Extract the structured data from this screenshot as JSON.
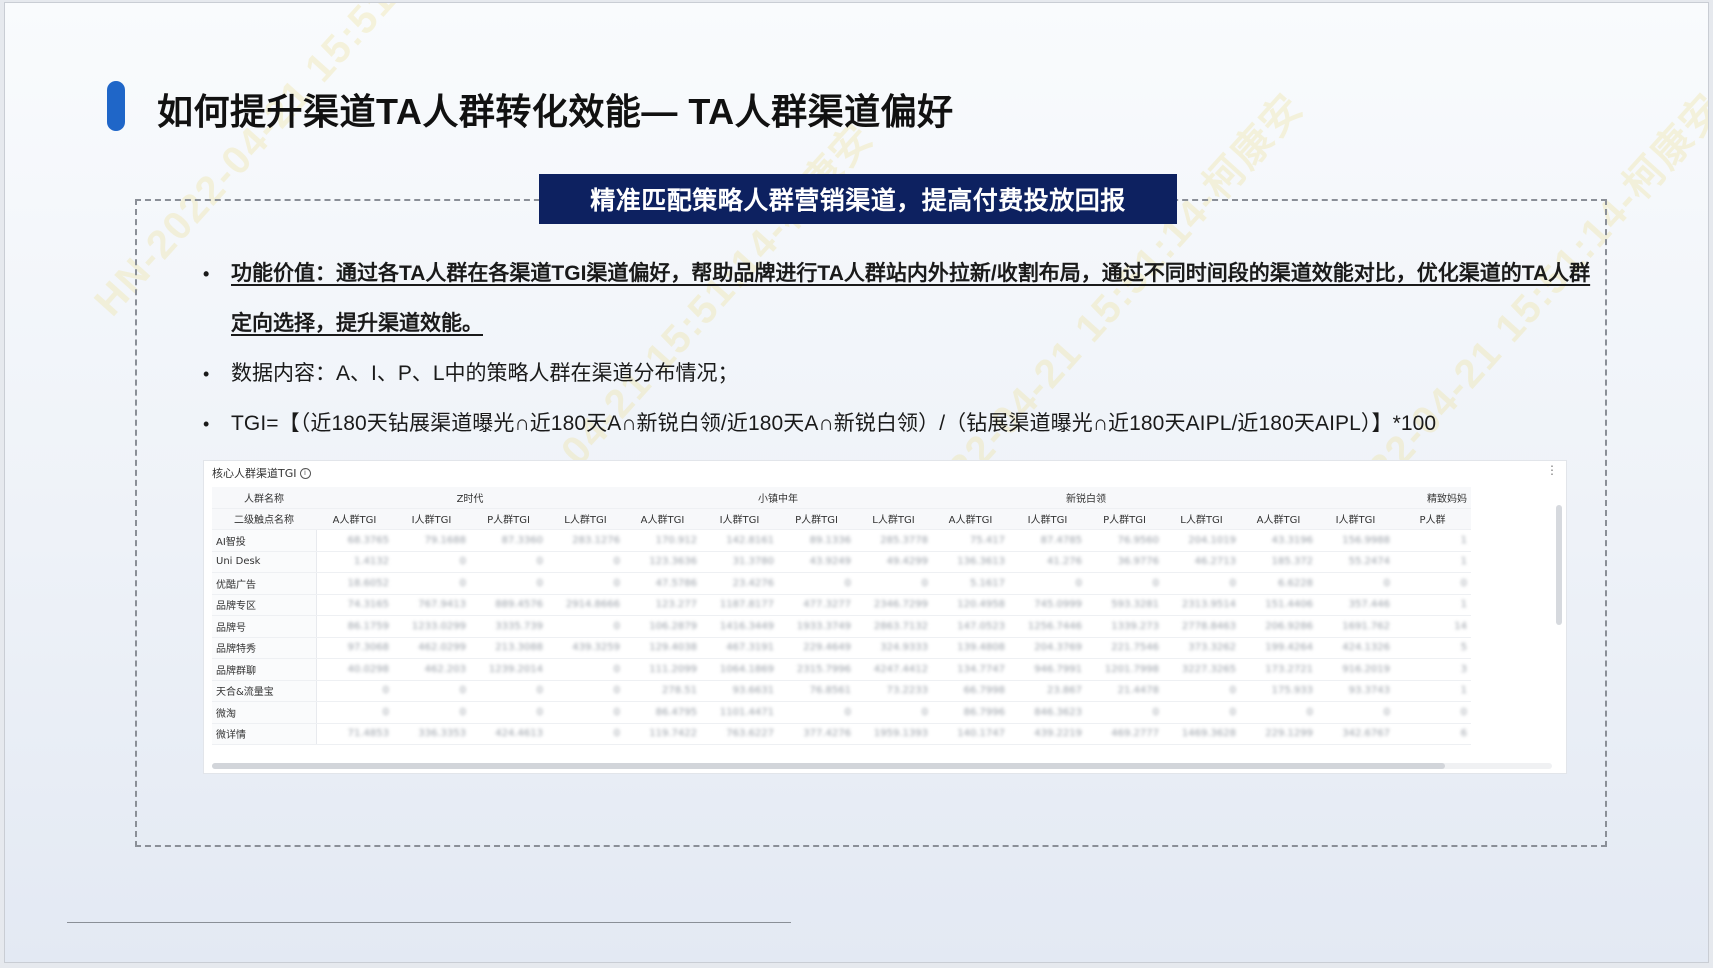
{
  "slide": {
    "title": "如何提升渠道TA人群转化效能— TA人群渠道偏好",
    "banner": "精准匹配策略人群营销渠道，提高付费投放回报",
    "bullets": [
      {
        "text": "功能价值：通过各TA人群在各渠道TGI渠道偏好，帮助品牌进行TA人群站内外拉新/收割布局，通过不同时间段的渠道效能对比，优化渠道的TA人群定向选择，提升渠道效能。",
        "style": "strong"
      },
      {
        "text": "数据内容：A、I、P、L中的策略人群在渠道分布情况；",
        "style": "normal"
      },
      {
        "text": "TGI=【（近180天钻展渠道曝光∩近180天A∩新锐白领/近180天A∩新锐白领）/（钻展渠道曝光∩近180天AIPL/近180天AIPL）】*100",
        "style": "tgi"
      }
    ],
    "bullet_symbol": "•"
  },
  "table": {
    "title": "核心人群渠道TGI",
    "info_icon": "info-icon",
    "more_icon": "more-icon",
    "corner_top": "人群名称",
    "corner_bottom": "二级触点名称",
    "groups": [
      {
        "name": "Z时代",
        "span": 4
      },
      {
        "name": "小镇中年",
        "span": 4
      },
      {
        "name": "新锐白领",
        "span": 4
      },
      {
        "name": "精致妈妈",
        "span": 3
      }
    ],
    "metrics": [
      "A人群TGI",
      "I人群TGI",
      "P人群TGI",
      "L人群TGI",
      "A人群TGI",
      "I人群TGI",
      "P人群TGI",
      "L人群TGI",
      "A人群TGI",
      "I人群TGI",
      "P人群TGI",
      "L人群TGI",
      "A人群TGI",
      "I人群TGI",
      "P人群"
    ],
    "rows": [
      {
        "name": "AI智投",
        "values": [
          "68.3765",
          "79.1688",
          "87.3360",
          "283.1276",
          "170.912",
          "142.8161",
          "89.1336",
          "285.3778",
          "75.417",
          "87.4785",
          "76.9560",
          "204.1019",
          "43.3196",
          "156.9988",
          "1"
        ]
      },
      {
        "name": "Uni Desk",
        "values": [
          "1.4132",
          "0",
          "0",
          "0",
          "123.3636",
          "31.3780",
          "43.9249",
          "49.4299",
          "136.3613",
          "41.276",
          "36.9776",
          "46.2713",
          "185.372",
          "55.2474",
          "1"
        ]
      },
      {
        "name": "优酷广告",
        "values": [
          "18.6052",
          "0",
          "0",
          "0",
          "47.5786",
          "23.4276",
          "0",
          "0",
          "5.1617",
          "0",
          "0",
          "0",
          "6.6228",
          "0",
          "0"
        ]
      },
      {
        "name": "品牌专区",
        "values": [
          "74.3165",
          "767.9413",
          "889.4576",
          "2914.8666",
          "123.277",
          "1187.8177",
          "477.3277",
          "2346.7299",
          "120.4958",
          "745.0999",
          "593.3281",
          "2313.9514",
          "151.4406",
          "357.446",
          "1"
        ]
      },
      {
        "name": "品牌号",
        "values": [
          "86.1759",
          "1233.0299",
          "3335.739",
          "0",
          "106.2879",
          "1416.3449",
          "1933.3749",
          "2863.7132",
          "147.0523",
          "1256.7446",
          "1339.273",
          "2778.8463",
          "206.9286",
          "1691.762",
          "14"
        ]
      },
      {
        "name": "品牌特秀",
        "values": [
          "97.3068",
          "462.0299",
          "213.3088",
          "439.3259",
          "129.4038",
          "467.3191",
          "229.4649",
          "324.9333",
          "139.4808",
          "204.3769",
          "221.7546",
          "373.3262",
          "199.4264",
          "424.1326",
          "5"
        ]
      },
      {
        "name": "品牌群聊",
        "values": [
          "40.0298",
          "462.203",
          "1239.2014",
          "0",
          "111.2099",
          "1064.1869",
          "2315.7996",
          "4247.4412",
          "134.7747",
          "946.7991",
          "1201.7998",
          "3227.3265",
          "173.2721",
          "916.2019",
          "3"
        ]
      },
      {
        "name": "天合&流量宝",
        "values": [
          "0",
          "0",
          "0",
          "0",
          "278.51",
          "93.6631",
          "76.8561",
          "73.2233",
          "66.7998",
          "23.867",
          "21.4478",
          "0",
          "175.933",
          "93.3743",
          "1"
        ]
      },
      {
        "name": "微淘",
        "values": [
          "0",
          "0",
          "0",
          "0",
          "86.4795",
          "1101.4471",
          "0",
          "0",
          "86.7996",
          "846.3623",
          "0",
          "0",
          "0",
          "0",
          "0"
        ]
      },
      {
        "name": "微详情",
        "values": [
          "71.4853",
          "336.3353",
          "424.4613",
          "0",
          "119.7422",
          "763.6227",
          "377.4276",
          "1959.1393",
          "140.1747",
          "439.2219",
          "469.2777",
          "1469.3628",
          "229.1299",
          "342.6767",
          "6"
        ]
      }
    ]
  },
  "colors": {
    "accent": "#1f66c8",
    "banner_bg": "#0d2160",
    "banner_text": "#ffffff"
  }
}
